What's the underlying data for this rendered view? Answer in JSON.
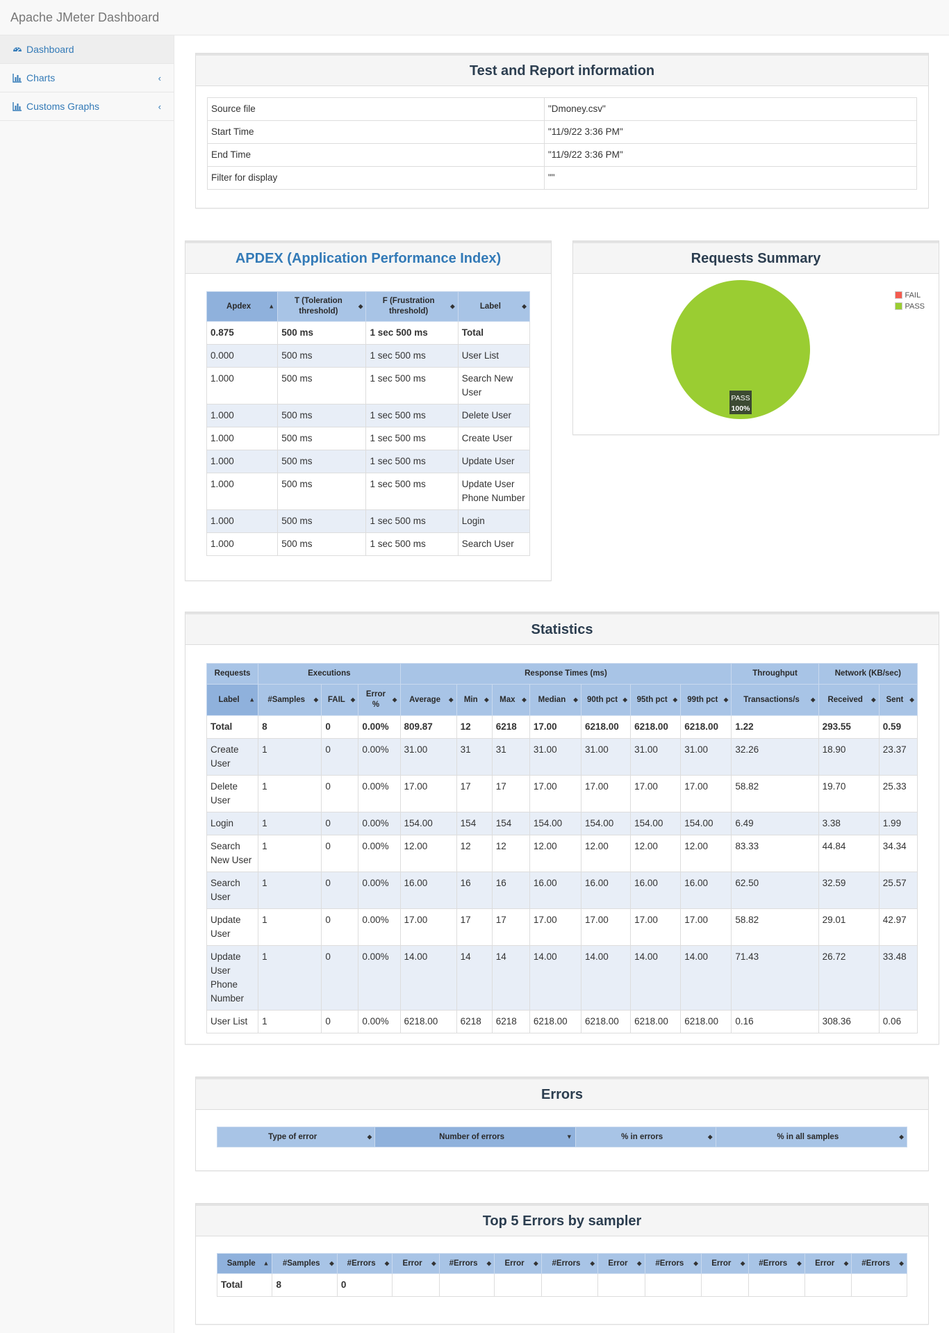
{
  "app": {
    "title": "Apache JMeter Dashboard"
  },
  "sidebar": {
    "items": [
      {
        "label": "Dashboard",
        "icon": "dashboard-icon",
        "active": true
      },
      {
        "label": "Charts",
        "icon": "bar-chart-icon",
        "chevron": "‹"
      },
      {
        "label": "Customs Graphs",
        "icon": "bar-chart-icon",
        "chevron": "‹"
      }
    ]
  },
  "colors": {
    "header": "#a8c4e6",
    "sorted_header": "#8fb1dc",
    "pass": "#9acd32",
    "fail": "#f45b4f",
    "alt_row": "#e8eef7",
    "link": "#337ab7"
  },
  "info": {
    "title": "Test and Report information",
    "rows": [
      [
        "Source file",
        "\"Dmoney.csv\""
      ],
      [
        "Start Time",
        "\"11/9/22 3:36 PM\""
      ],
      [
        "End Time",
        "\"11/9/22 3:36 PM\""
      ],
      [
        "Filter for display",
        "\"\""
      ]
    ]
  },
  "apdex": {
    "title": "APDEX (Application Performance Index)",
    "headers": [
      "Apdex",
      "T (Toleration threshold)",
      "F (Frustration threshold)",
      "Label"
    ],
    "rows": [
      [
        "0.875",
        "500 ms",
        "1 sec 500 ms",
        "Total"
      ],
      [
        "0.000",
        "500 ms",
        "1 sec 500 ms",
        "User List"
      ],
      [
        "1.000",
        "500 ms",
        "1 sec 500 ms",
        "Search New User"
      ],
      [
        "1.000",
        "500 ms",
        "1 sec 500 ms",
        "Delete User"
      ],
      [
        "1.000",
        "500 ms",
        "1 sec 500 ms",
        "Create User"
      ],
      [
        "1.000",
        "500 ms",
        "1 sec 500 ms",
        "Update User"
      ],
      [
        "1.000",
        "500 ms",
        "1 sec 500 ms",
        "Update User Phone Number"
      ],
      [
        "1.000",
        "500 ms",
        "1 sec 500 ms",
        "Login"
      ],
      [
        "1.000",
        "500 ms",
        "1 sec 500 ms",
        "Search User"
      ]
    ]
  },
  "summary": {
    "title": "Requests Summary",
    "legend": [
      "FAIL",
      "PASS"
    ],
    "slice_label": "PASS",
    "slice_pct": "100%"
  },
  "chart_data": {
    "type": "pie",
    "title": "Requests Summary",
    "categories": [
      "FAIL",
      "PASS"
    ],
    "values": [
      0,
      100
    ],
    "colors": [
      "#f45b4f",
      "#9acd32"
    ],
    "legend": "top-right"
  },
  "statistics": {
    "title": "Statistics",
    "groups": [
      "Requests",
      "Executions",
      "Response Times (ms)",
      "Throughput",
      "Network (KB/sec)"
    ],
    "headers": [
      "Label",
      "#Samples",
      "FAIL",
      "Error %",
      "Average",
      "Min",
      "Max",
      "Median",
      "90th pct",
      "95th pct",
      "99th pct",
      "Transactions/s",
      "Received",
      "Sent"
    ],
    "rows": [
      [
        "Total",
        "8",
        "0",
        "0.00%",
        "809.87",
        "12",
        "6218",
        "17.00",
        "6218.00",
        "6218.00",
        "6218.00",
        "1.22",
        "293.55",
        "0.59"
      ],
      [
        "Create User",
        "1",
        "0",
        "0.00%",
        "31.00",
        "31",
        "31",
        "31.00",
        "31.00",
        "31.00",
        "31.00",
        "32.26",
        "18.90",
        "23.37"
      ],
      [
        "Delete User",
        "1",
        "0",
        "0.00%",
        "17.00",
        "17",
        "17",
        "17.00",
        "17.00",
        "17.00",
        "17.00",
        "58.82",
        "19.70",
        "25.33"
      ],
      [
        "Login",
        "1",
        "0",
        "0.00%",
        "154.00",
        "154",
        "154",
        "154.00",
        "154.00",
        "154.00",
        "154.00",
        "6.49",
        "3.38",
        "1.99"
      ],
      [
        "Search New User",
        "1",
        "0",
        "0.00%",
        "12.00",
        "12",
        "12",
        "12.00",
        "12.00",
        "12.00",
        "12.00",
        "83.33",
        "44.84",
        "34.34"
      ],
      [
        "Search User",
        "1",
        "0",
        "0.00%",
        "16.00",
        "16",
        "16",
        "16.00",
        "16.00",
        "16.00",
        "16.00",
        "62.50",
        "32.59",
        "25.57"
      ],
      [
        "Update User",
        "1",
        "0",
        "0.00%",
        "17.00",
        "17",
        "17",
        "17.00",
        "17.00",
        "17.00",
        "17.00",
        "58.82",
        "29.01",
        "42.97"
      ],
      [
        "Update User Phone Number",
        "1",
        "0",
        "0.00%",
        "14.00",
        "14",
        "14",
        "14.00",
        "14.00",
        "14.00",
        "14.00",
        "71.43",
        "26.72",
        "33.48"
      ],
      [
        "User List",
        "1",
        "0",
        "0.00%",
        "6218.00",
        "6218",
        "6218",
        "6218.00",
        "6218.00",
        "6218.00",
        "6218.00",
        "0.16",
        "308.36",
        "0.06"
      ]
    ]
  },
  "errors": {
    "title": "Errors",
    "headers": [
      "Type of error",
      "Number of errors",
      "% in errors",
      "% in all samples"
    ]
  },
  "top5": {
    "title": "Top 5 Errors by sampler",
    "headers": [
      "Sample",
      "#Samples",
      "#Errors",
      "Error",
      "#Errors",
      "Error",
      "#Errors",
      "Error",
      "#Errors",
      "Error",
      "#Errors",
      "Error",
      "#Errors"
    ],
    "rows": [
      [
        "Total",
        "8",
        "0",
        "",
        "",
        "",
        "",
        "",
        "",
        "",
        "",
        "",
        ""
      ]
    ]
  }
}
